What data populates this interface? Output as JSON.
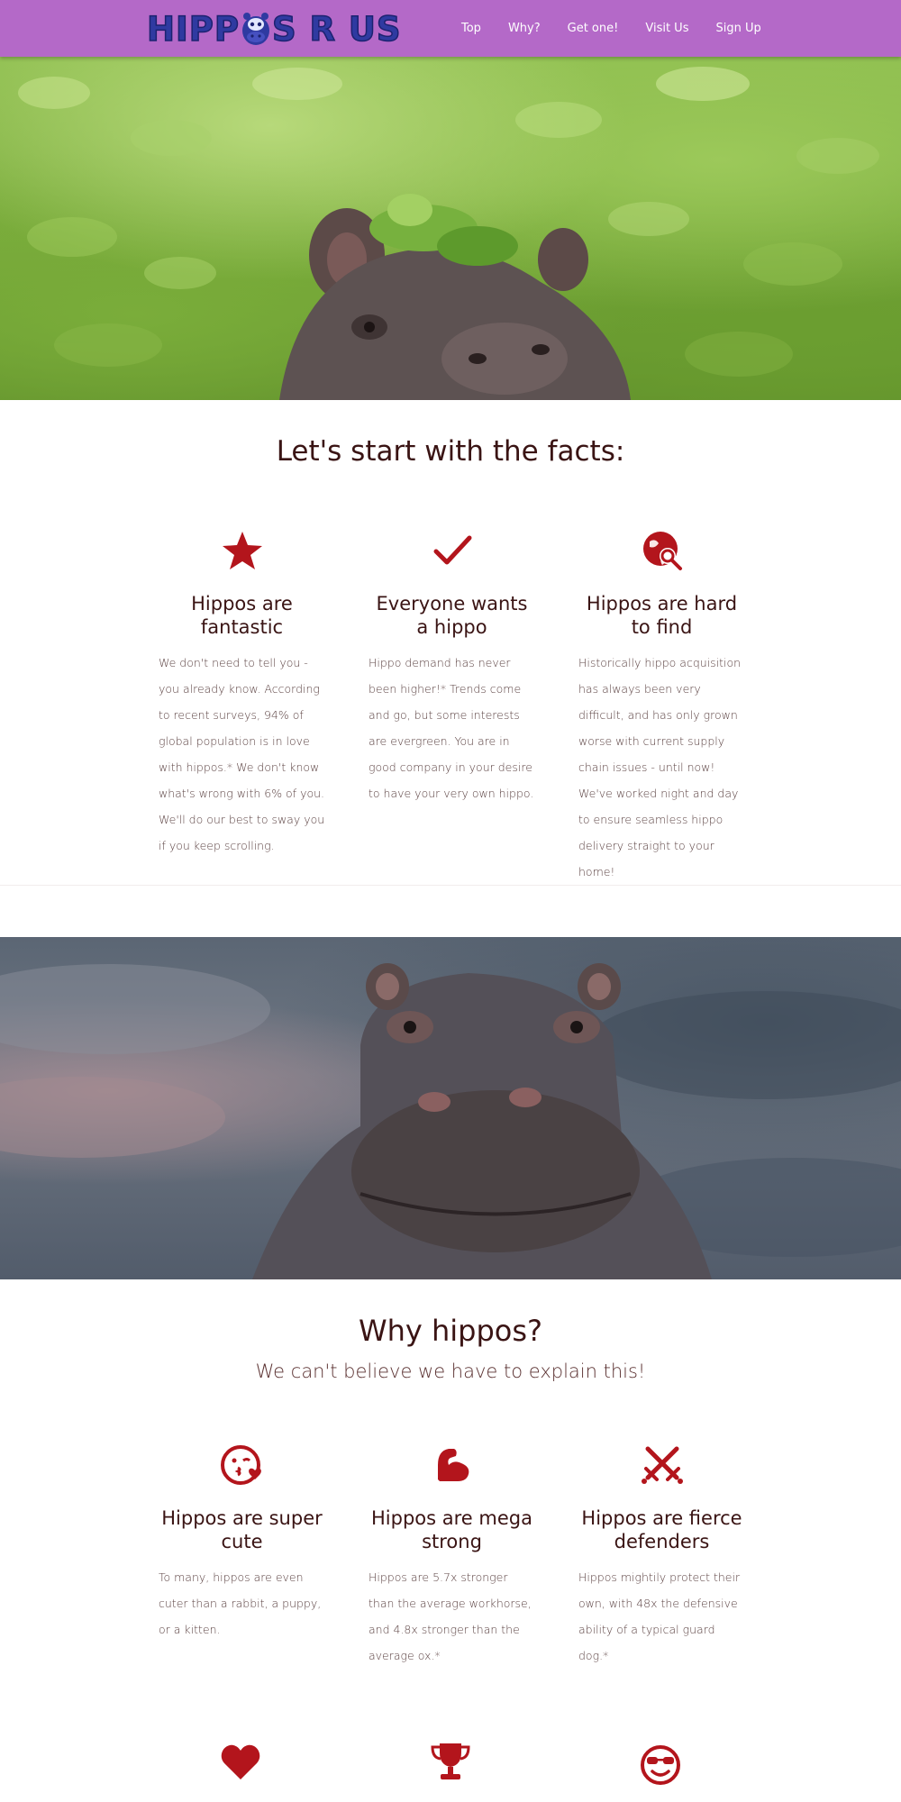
{
  "brand": {
    "logo_text_left": "HIPP",
    "logo_text_right": "S R US"
  },
  "nav": {
    "items": [
      "Top",
      "Why?",
      "Get one!",
      "Visit Us",
      "Sign Up"
    ]
  },
  "facts": {
    "title": "Let's start with the facts:",
    "features": [
      {
        "icon": "star-icon",
        "title": "Hippos are fantastic",
        "body": "We don't need to tell you - you already know. According to recent surveys, 94% of global population is in love with hippos.* We don't know what's wrong with 6% of you. We'll do our best to sway you if you keep scrolling."
      },
      {
        "icon": "checkmark-icon",
        "title": "Everyone wants a hippo",
        "body": "Hippo demand has never been higher!* Trends come and go, but some interests are evergreen. You are in good company in your desire to have your very own hippo."
      },
      {
        "icon": "globe-search-icon",
        "title": "Hippos are hard to find",
        "body": "Historically hippo acquisition has always been very difficult, and has only grown worse with current supply chain issues - until now! We've worked night and day to ensure seamless hippo delivery straight to your home!"
      }
    ]
  },
  "why": {
    "title": "Why hippos?",
    "subtitle": "We can't believe we have to explain this!",
    "features": [
      {
        "icon": "kiss-face-icon",
        "title": "Hippos are super cute",
        "body": "To many, hippos are even cuter than a rabbit, a puppy, or a kitten."
      },
      {
        "icon": "flexed-bicep-icon",
        "title": "Hippos are mega strong",
        "body": "Hippos are 5.7x stronger than the average workhorse, and 4.8x stronger than the average ox.*"
      },
      {
        "icon": "crossed-swords-icon",
        "title": "Hippos are fierce defenders",
        "body": "Hippos mightily protect their own, with 48x the defensive ability of a typical guard dog.*"
      }
    ],
    "more_icons": [
      "heart-icon",
      "trophy-icon",
      "sunglasses-face-icon"
    ]
  },
  "colors": {
    "nav": "#b469c8",
    "accent": "#b3151c",
    "logo": "#2f3aa1",
    "text": "#3a1414"
  }
}
